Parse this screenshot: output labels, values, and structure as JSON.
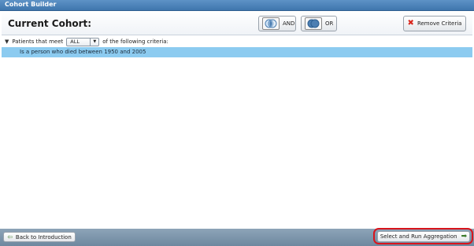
{
  "window": {
    "title": "Cohort Builder"
  },
  "header": {
    "title": "Current Cohort:"
  },
  "toolbar": {
    "and_label": "AND",
    "or_label": "OR",
    "remove_label": "Remove Criteria"
  },
  "criteria": {
    "prefix": "Patients that meet",
    "match_selected": "ALL",
    "suffix": "of the following criteria:",
    "items": [
      "Is a person who died between 1950 and 2005"
    ]
  },
  "footer": {
    "back_label": "Back to Introduction",
    "run_label": "Select and Run Aggregation"
  },
  "colors": {
    "accent": "#8ccbf0",
    "titlebar": "#4a80b8",
    "highlight": "#d8141c"
  }
}
